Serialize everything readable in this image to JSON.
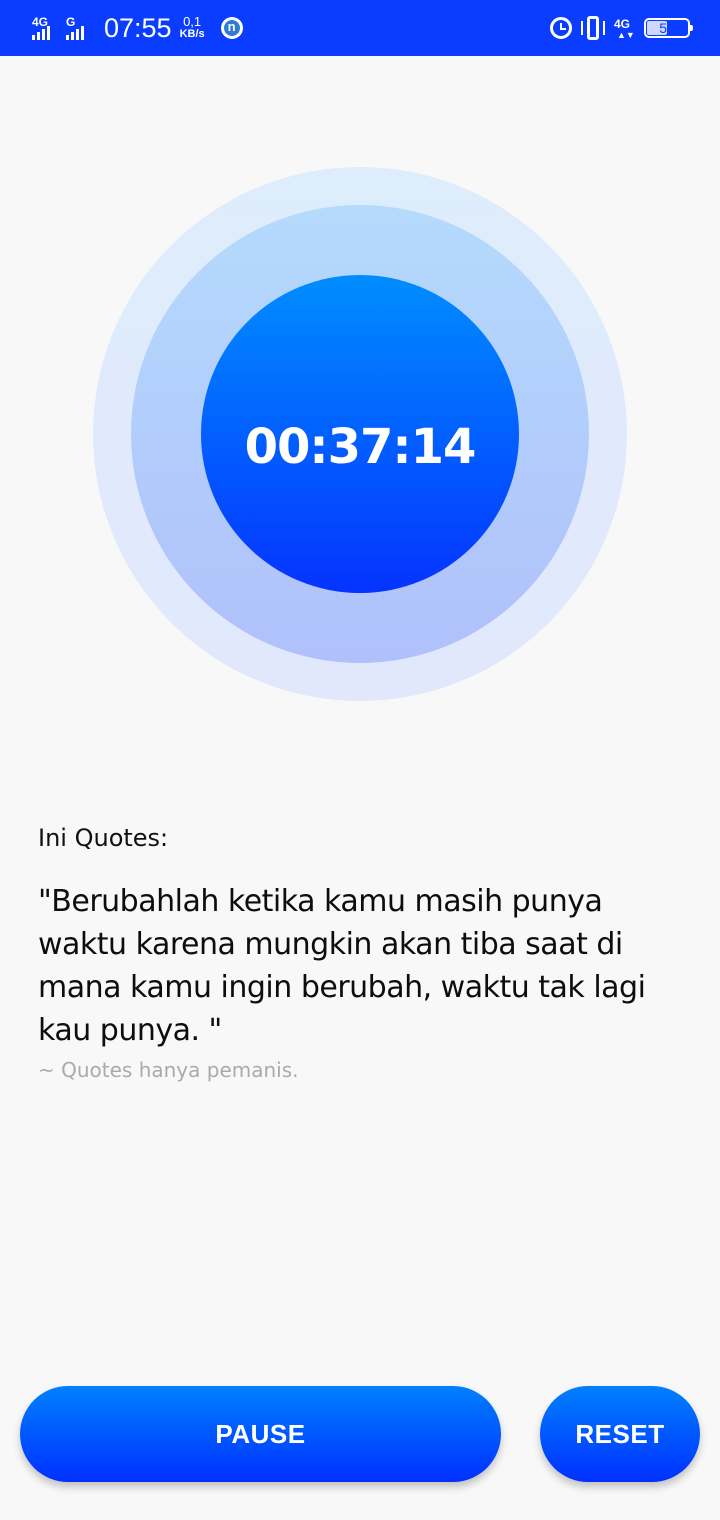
{
  "status_bar": {
    "network_1": "4G",
    "network_2": "G",
    "time": "07:55",
    "speed_value": "0,1",
    "speed_unit": "KB/s",
    "app_icon_letter": "n",
    "network_right": "4G",
    "battery_level": "50",
    "battery_fraction": 0.5,
    "background_color": "#0a3dff"
  },
  "timer": {
    "display": "00:37:14"
  },
  "quote": {
    "heading": "Ini Quotes:",
    "text": "\"Berubahlah ketika kamu masih punya waktu karena mungkin akan tiba saat di mana kamu ingin berubah, waktu tak lagi kau punya. \"",
    "source": "~ Quotes hanya pemanis."
  },
  "buttons": {
    "pause_label": "PAUSE",
    "reset_label": "RESET"
  },
  "colors": {
    "accent": "#0a3dff",
    "gradient_top": "#0080ff",
    "gradient_bottom": "#0030ff",
    "background": "#f8f8f8"
  }
}
